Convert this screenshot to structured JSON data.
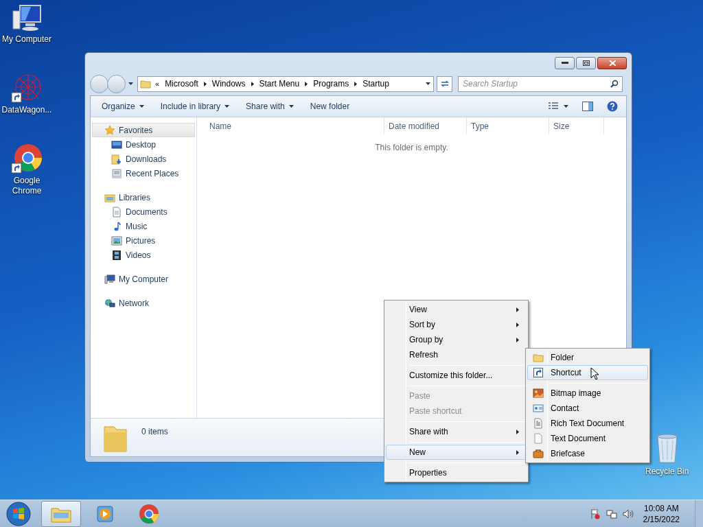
{
  "desktop_icons": [
    {
      "label": "My Computer",
      "kind": "computer"
    },
    {
      "label": "DataWagon...",
      "kind": "app"
    },
    {
      "label": "Google Chrome",
      "kind": "chrome"
    }
  ],
  "recycle_bin": {
    "label": "Recycle Bin"
  },
  "window": {
    "breadcrumb_overflow": "«",
    "breadcrumb": [
      "Microsoft",
      "Windows",
      "Start Menu",
      "Programs",
      "Startup"
    ],
    "search": {
      "placeholder": "Search Startup"
    },
    "toolbar": [
      {
        "label": "Organize",
        "dropdown": true
      },
      {
        "label": "Include in library",
        "dropdown": true
      },
      {
        "label": "Share with",
        "dropdown": true
      },
      {
        "label": "New folder",
        "dropdown": false
      }
    ],
    "nav": [
      {
        "label": "Favorites",
        "kind": "star",
        "selected": true,
        "children": [
          {
            "label": "Desktop",
            "kind": "desktop",
            "selected": false
          },
          {
            "label": "Downloads",
            "kind": "downloads",
            "selected": false
          },
          {
            "label": "Recent Places",
            "kind": "recent",
            "selected": false
          }
        ]
      },
      {
        "label": "Libraries",
        "kind": "libraries",
        "selected": false,
        "children": [
          {
            "label": "Documents",
            "kind": "document",
            "selected": false
          },
          {
            "label": "Music",
            "kind": "music",
            "selected": false
          },
          {
            "label": "Pictures",
            "kind": "pictures",
            "selected": false
          },
          {
            "label": "Videos",
            "kind": "videos",
            "selected": false
          }
        ]
      },
      {
        "label": "My Computer",
        "kind": "computer",
        "selected": false
      },
      {
        "label": "Network",
        "kind": "network",
        "selected": false
      }
    ],
    "columns": [
      "Name",
      "Date modified",
      "Type",
      "Size"
    ],
    "empty_message": "This folder is empty.",
    "status": "0 items"
  },
  "context_menu": [
    {
      "kind": "item",
      "label": "View",
      "submenu": true,
      "disabled": false,
      "selected": false
    },
    {
      "kind": "item",
      "label": "Sort by",
      "submenu": true,
      "disabled": false,
      "selected": false
    },
    {
      "kind": "item",
      "label": "Group by",
      "submenu": true,
      "disabled": false,
      "selected": false
    },
    {
      "kind": "item",
      "label": "Refresh",
      "submenu": false,
      "disabled": false,
      "selected": false
    },
    {
      "kind": "separator"
    },
    {
      "kind": "item",
      "label": "Customize this folder...",
      "submenu": false,
      "disabled": false,
      "selected": false
    },
    {
      "kind": "separator"
    },
    {
      "kind": "item",
      "label": "Paste",
      "submenu": false,
      "disabled": true,
      "selected": false
    },
    {
      "kind": "item",
      "label": "Paste shortcut",
      "submenu": false,
      "disabled": true,
      "selected": false
    },
    {
      "kind": "separator"
    },
    {
      "kind": "item",
      "label": "Share with",
      "submenu": true,
      "disabled": false,
      "selected": false
    },
    {
      "kind": "separator"
    },
    {
      "kind": "item",
      "label": "New",
      "submenu": true,
      "disabled": false,
      "selected": true
    },
    {
      "kind": "separator"
    },
    {
      "kind": "item",
      "label": "Properties",
      "submenu": false,
      "disabled": false,
      "selected": false
    }
  ],
  "submenu": [
    {
      "kind": "folder",
      "label": "Folder",
      "selected": false
    },
    {
      "kind": "shortcut",
      "label": "Shortcut",
      "selected": true
    },
    {
      "kind": "separator"
    },
    {
      "kind": "bitmap",
      "label": "Bitmap image",
      "selected": false
    },
    {
      "kind": "contact",
      "label": "Contact",
      "selected": false
    },
    {
      "kind": "rtf",
      "label": "Rich Text Document",
      "selected": false
    },
    {
      "kind": "text",
      "label": "Text Document",
      "selected": false
    },
    {
      "kind": "briefcase",
      "label": "Briefcase",
      "selected": false
    }
  ],
  "taskbar": {
    "buttons": [
      {
        "kind": "explorer",
        "selected": true
      },
      {
        "kind": "media",
        "selected": false
      },
      {
        "kind": "chrome",
        "selected": false
      }
    ],
    "time": "10:08 AM",
    "date": "2/15/2022"
  }
}
